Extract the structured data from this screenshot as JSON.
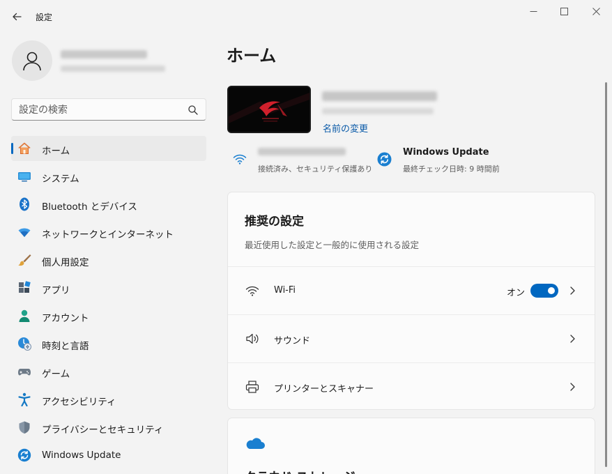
{
  "app": {
    "title": "設定"
  },
  "search": {
    "placeholder": "設定の検索"
  },
  "sidebar": {
    "items": [
      {
        "label": "ホーム",
        "icon": "home-icon"
      },
      {
        "label": "システム",
        "icon": "system-icon"
      },
      {
        "label": "Bluetooth とデバイス",
        "icon": "bluetooth-icon"
      },
      {
        "label": "ネットワークとインターネット",
        "icon": "network-icon"
      },
      {
        "label": "個人用設定",
        "icon": "brush-icon"
      },
      {
        "label": "アプリ",
        "icon": "apps-icon"
      },
      {
        "label": "アカウント",
        "icon": "account-icon"
      },
      {
        "label": "時刻と言語",
        "icon": "time-language-icon"
      },
      {
        "label": "ゲーム",
        "icon": "gaming-icon"
      },
      {
        "label": "アクセシビリティ",
        "icon": "accessibility-icon"
      },
      {
        "label": "プライバシーとセキュリティ",
        "icon": "shield-icon"
      },
      {
        "label": "Windows Update",
        "icon": "windows-update-icon"
      }
    ]
  },
  "main": {
    "title": "ホーム",
    "device": {
      "rename_label": "名前の変更"
    },
    "network": {
      "status": "接続済み、セキュリティ保護あり"
    },
    "update": {
      "title": "Windows Update",
      "status": "最終チェック日時: 9 時間前"
    },
    "recommended": {
      "title": "推奨の設定",
      "subtitle": "最近使用した設定と一般的に使用される設定",
      "rows": [
        {
          "label": "Wi-Fi",
          "toggle_text": "オン",
          "toggle_on": true,
          "icon": "wifi-icon"
        },
        {
          "label": "サウンド",
          "icon": "speaker-icon"
        },
        {
          "label": "プリンターとスキャナー",
          "icon": "printer-icon"
        }
      ]
    },
    "cloud": {
      "title": "クラウド ストレージ",
      "icon": "cloud-icon"
    }
  },
  "colors": {
    "accent": "#0067c0",
    "background": "#f3f3f3",
    "card": "#fbfbfb"
  }
}
